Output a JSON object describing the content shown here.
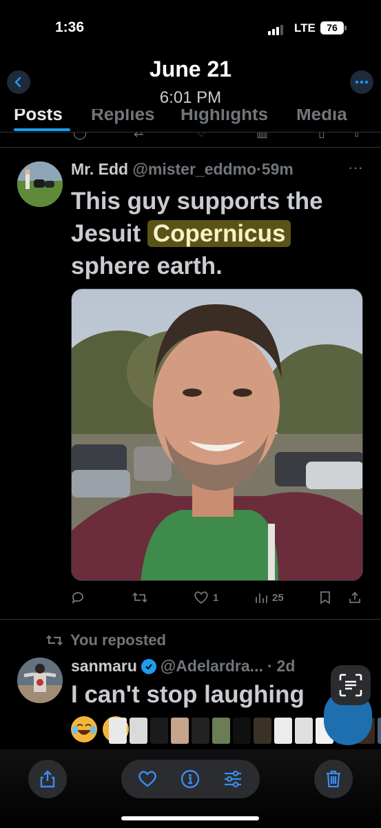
{
  "status_bar": {
    "time": "1:36",
    "network": "LTE",
    "battery_level": "76"
  },
  "nav": {
    "date": "June 21",
    "time": "6:01 PM",
    "back_icon": "chevron-left-icon",
    "more_icon": "ellipsis-icon"
  },
  "tabs": [
    {
      "label": "Posts",
      "active": true
    },
    {
      "label": "Replies",
      "active": false
    },
    {
      "label": "Highlights",
      "active": false
    },
    {
      "label": "Media",
      "active": false
    }
  ],
  "tweet1": {
    "name": "Mr. Edd",
    "handle": "@mister_eddmo",
    "separator": "·",
    "age": "59m",
    "text_before": "This guy supports the Jesuit ",
    "text_highlight": "Copernicus",
    "text_after": " sphere earth.",
    "likes": "1",
    "views": "25"
  },
  "repost_label": "You reposted",
  "tweet2": {
    "name": "sanmaru",
    "handle": "@Adelardra...",
    "separator": "·",
    "age": "2d",
    "text": "I can't stop laughing"
  },
  "colors": {
    "accent": "#1d9bf0",
    "highlight_bg": "#5a5318",
    "background": "#000000"
  },
  "toolbar_icons": [
    "share-icon",
    "heart-icon",
    "info-icon",
    "sliders-icon",
    "trash-icon"
  ]
}
